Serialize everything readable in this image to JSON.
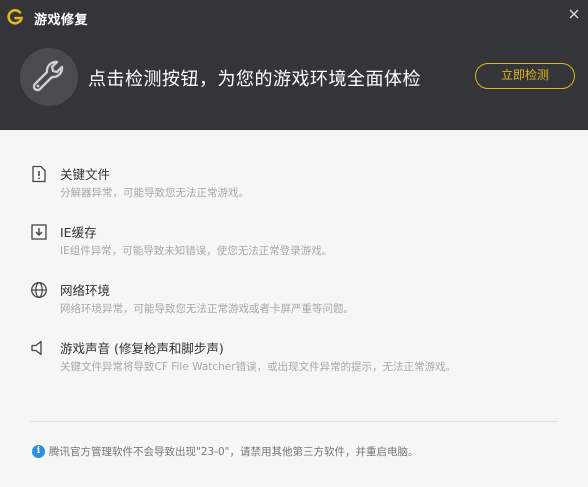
{
  "window": {
    "title": "游戏修复"
  },
  "header": {
    "headline": "点击检测按钮，为您的游戏环境全面体检",
    "detect_button": "立即检测"
  },
  "items": [
    {
      "icon": "warning-file-icon",
      "title": "关键文件",
      "desc": "分解器异常，可能导致您无法正常游戏。"
    },
    {
      "icon": "download-cache-icon",
      "title": "IE缓存",
      "desc": "IE组件异常，可能导致未知错误，使您无法正常登录游戏。"
    },
    {
      "icon": "globe-icon",
      "title": "网络环境",
      "desc": "网络环境异常，可能导致您无法正常游戏或者卡屏严重等问题。"
    },
    {
      "icon": "speaker-icon",
      "title": "游戏声音 (修复枪声和脚步声)",
      "desc": "关键文件异常将导致CF File Watcher错误，或出现文件异常的提示，无法正常游戏。"
    }
  ],
  "footer": {
    "info_icon": "info-icon",
    "text": "腾讯官方管理软件不会导致出现\"23-0\"，请禁用其他第三方软件，并重启电脑。"
  },
  "colors": {
    "header_bg": "#333538",
    "accent": "#e3b51e",
    "info_blue": "#2b8fe3"
  }
}
